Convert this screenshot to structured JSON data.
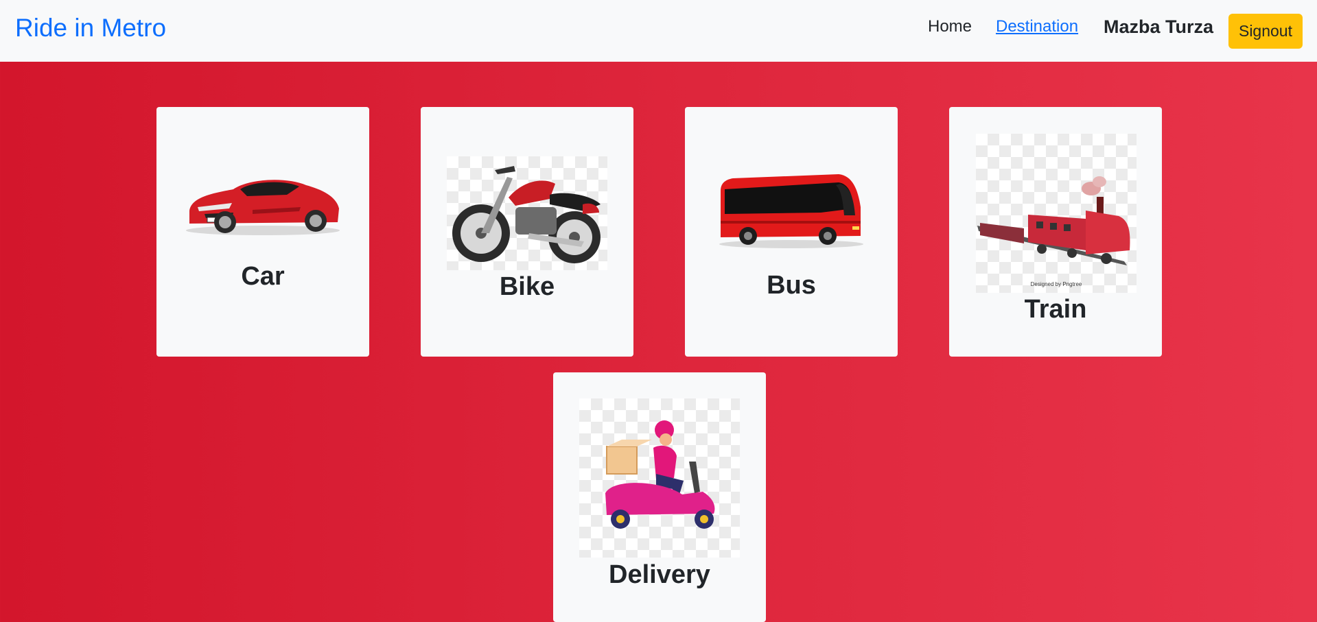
{
  "navbar": {
    "brand": "Ride in Metro",
    "links": [
      {
        "label": "Home"
      },
      {
        "label": "Destination"
      }
    ],
    "user_name": "Mazba Turza",
    "signout_label": "Signout"
  },
  "cards": [
    {
      "label": "Car",
      "icon": "car-image"
    },
    {
      "label": "Bike",
      "icon": "motorcycle-image"
    },
    {
      "label": "Bus",
      "icon": "bus-image"
    },
    {
      "label": "Train",
      "icon": "train-image",
      "credit": "Designed by Pngtree"
    },
    {
      "label": "Delivery",
      "icon": "delivery-scooter-image"
    }
  ],
  "colors": {
    "brand": "#0d6efd",
    "background_start": "#d3162c",
    "background_end": "#e8344a",
    "signout": "#ffc107",
    "card": "#f8f9fa"
  }
}
